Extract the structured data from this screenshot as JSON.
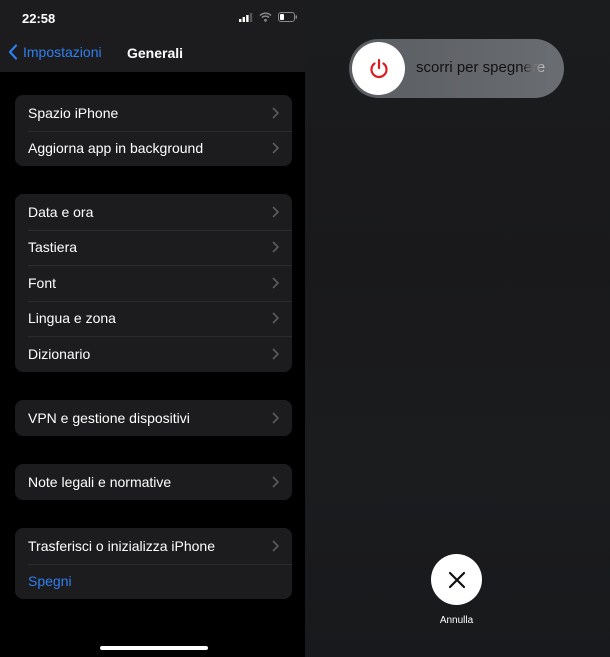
{
  "status_bar": {
    "time": "22:58",
    "icons": [
      "signal-icon",
      "wifi-icon",
      "battery-icon"
    ]
  },
  "nav": {
    "back_label": "Impostazioni",
    "title": "Generali"
  },
  "groups": [
    {
      "items": [
        {
          "label": "Spazio iPhone",
          "chevron": true
        },
        {
          "label": "Aggiorna app in background",
          "chevron": true
        }
      ]
    },
    {
      "items": [
        {
          "label": "Data e ora",
          "chevron": true
        },
        {
          "label": "Tastiera",
          "chevron": true
        },
        {
          "label": "Font",
          "chevron": true
        },
        {
          "label": "Lingua e zona",
          "chevron": true
        },
        {
          "label": "Dizionario",
          "chevron": true
        }
      ]
    },
    {
      "items": [
        {
          "label": "VPN e gestione dispositivi",
          "chevron": true
        }
      ]
    },
    {
      "items": [
        {
          "label": "Note legali e normative",
          "chevron": true
        }
      ]
    },
    {
      "items": [
        {
          "label": "Trasferisci o inizializza iPhone",
          "chevron": true
        },
        {
          "label": "Spegni",
          "chevron": false,
          "accent": true
        }
      ]
    }
  ],
  "power_off": {
    "slider_label": "scorri per spegnere",
    "knob_icon": "power-icon",
    "cancel_label": "Annulla",
    "cancel_icon": "close-icon"
  },
  "colors": {
    "accent": "#2f7ff0",
    "power_icon": "#e0191f",
    "cell_bg": "#1c1c1e"
  }
}
